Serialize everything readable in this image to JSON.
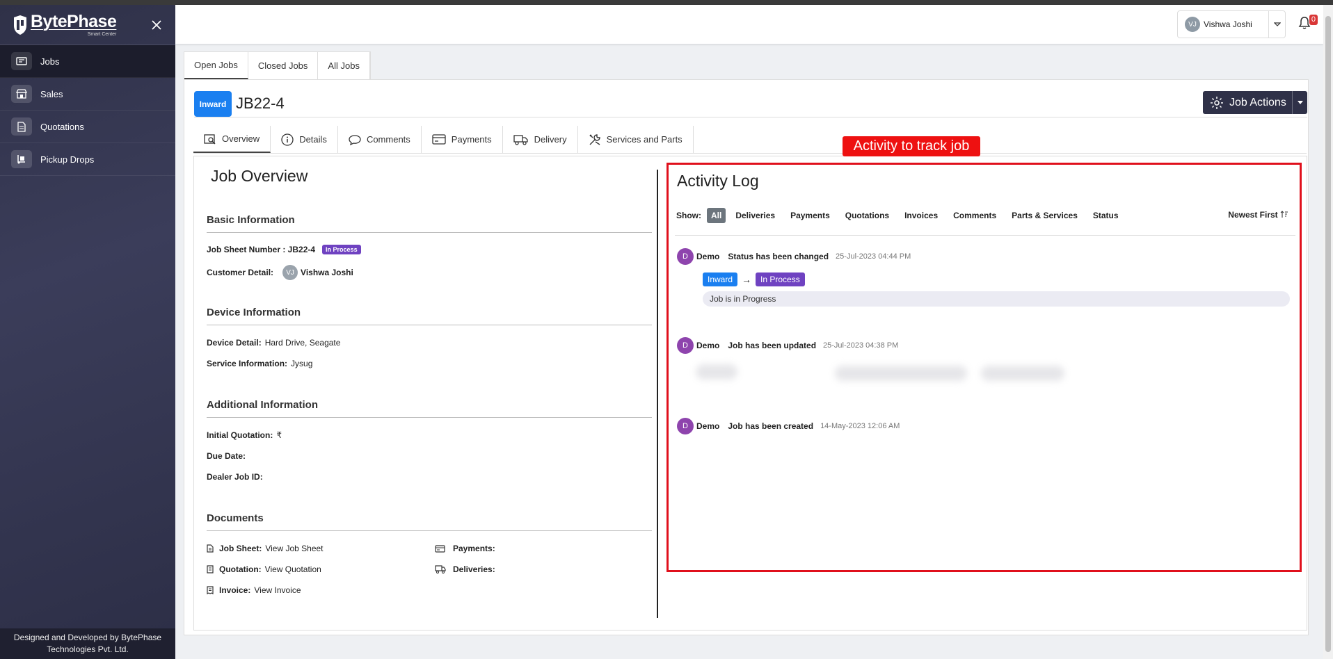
{
  "brand": {
    "name": "BytePhase",
    "tagline": "Smart Center"
  },
  "sidebar": {
    "items": [
      {
        "label": "Jobs",
        "icon": "jobs-icon"
      },
      {
        "label": "Sales",
        "icon": "store-icon"
      },
      {
        "label": "Quotations",
        "icon": "document-icon"
      },
      {
        "label": "Pickup Drops",
        "icon": "dolly-icon"
      }
    ],
    "footer": "Designed and Developed by BytePhase Technologies Pvt. Ltd."
  },
  "header": {
    "user_initials": "VJ",
    "user_name": "Vishwa Joshi",
    "notifications": "0"
  },
  "top_tabs": [
    "Open Jobs",
    "Closed Jobs",
    "All Jobs"
  ],
  "job": {
    "status_button": "Inward",
    "number": "JB22-4",
    "actions_label": "Job Actions"
  },
  "sub_tabs": [
    "Overview",
    "Details",
    "Comments",
    "Payments",
    "Delivery",
    "Services and Parts"
  ],
  "overview": {
    "title": "Job Overview",
    "basic": {
      "heading": "Basic Information",
      "job_sheet_label": "Job Sheet Number : JB22-4",
      "status_badge": "In Process",
      "customer_label": "Customer Detail:",
      "customer_initials": "VJ",
      "customer_name": "Vishwa Joshi"
    },
    "device": {
      "heading": "Device Information",
      "detail_label": "Device Detail:",
      "detail_value": "Hard Drive, Seagate",
      "service_label": "Service Information:",
      "service_value": "Jysug"
    },
    "additional": {
      "heading": "Additional Information",
      "quotation_label": "Initial Quotation:",
      "quotation_value": "₹",
      "due_label": "Due Date:",
      "dealer_label": "Dealer Job ID:"
    },
    "documents": {
      "heading": "Documents",
      "job_sheet_label": "Job Sheet:",
      "job_sheet_link": "View Job Sheet",
      "quotation_label": "Quotation:",
      "quotation_link": "View Quotation",
      "invoice_label": "Invoice:",
      "invoice_link": "View Invoice",
      "payments_label": "Payments:",
      "deliveries_label": "Deliveries:"
    }
  },
  "callout": "Activity to track job",
  "activity": {
    "title": "Activity Log",
    "show_label": "Show:",
    "filters": [
      "All",
      "Deliveries",
      "Payments",
      "Quotations",
      "Invoices",
      "Comments",
      "Parts & Services",
      "Status"
    ],
    "sort_label": "Newest First",
    "entries": [
      {
        "initial": "D",
        "user": "Demo",
        "action": "Status has been changed",
        "time": "25-Jul-2023 04:44 PM",
        "from": "Inward",
        "to": "In Process",
        "note": "Job is in Progress"
      },
      {
        "initial": "D",
        "user": "Demo",
        "action": "Job has been updated",
        "time": "25-Jul-2023 04:38 PM"
      },
      {
        "initial": "D",
        "user": "Demo",
        "action": "Job has been created",
        "time": "14-May-2023 12:06 AM"
      }
    ]
  },
  "colors": {
    "primary": "#1a7ff0",
    "sidebar": "#2f3148",
    "status": "#6f42c1",
    "highlight": "#e0101c"
  }
}
